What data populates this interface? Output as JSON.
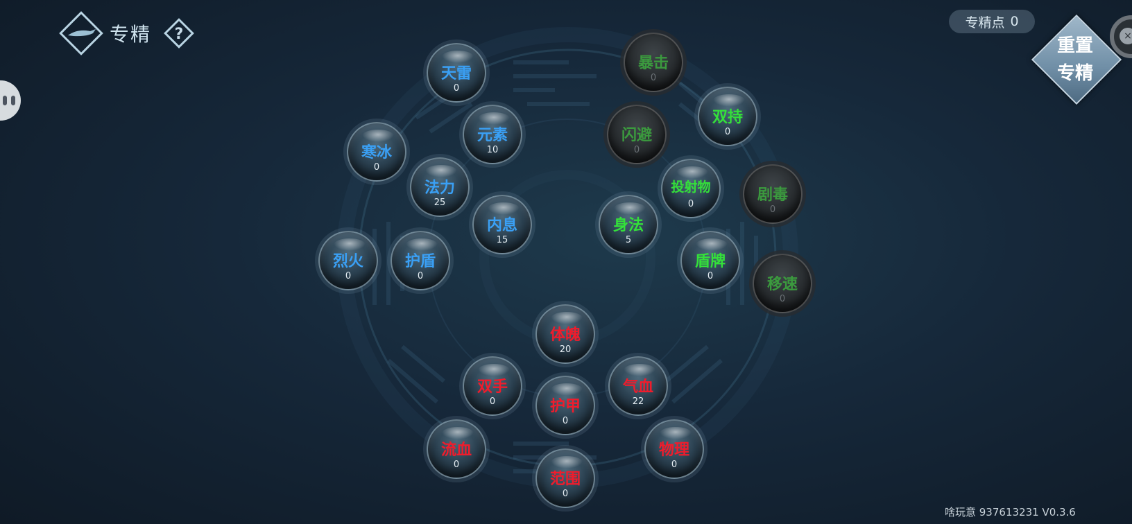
{
  "header": {
    "title": "专精"
  },
  "points": {
    "label": "专精点",
    "value": "0"
  },
  "reset": {
    "line1": "重置",
    "line2": "专精"
  },
  "colors": {
    "blue": "#3aa0f5",
    "green": "#34e03a",
    "red": "#f01c2c",
    "locked": "#3b9a3e"
  },
  "nodes": [
    {
      "name": "天雷",
      "value": "0",
      "group": "blue",
      "locked": false
    },
    {
      "name": "元素",
      "value": "10",
      "group": "blue",
      "locked": false
    },
    {
      "name": "寒冰",
      "value": "0",
      "group": "blue",
      "locked": false
    },
    {
      "name": "法力",
      "value": "25",
      "group": "blue",
      "locked": false
    },
    {
      "name": "内息",
      "value": "15",
      "group": "blue",
      "locked": false
    },
    {
      "name": "烈火",
      "value": "0",
      "group": "blue",
      "locked": false
    },
    {
      "name": "护盾",
      "value": "0",
      "group": "blue",
      "locked": false
    },
    {
      "name": "暴击",
      "value": "0",
      "group": "green",
      "locked": true
    },
    {
      "name": "双持",
      "value": "0",
      "group": "green",
      "locked": false
    },
    {
      "name": "闪避",
      "value": "0",
      "group": "green",
      "locked": true
    },
    {
      "name": "投射物",
      "value": "0",
      "group": "green",
      "locked": false
    },
    {
      "name": "剧毒",
      "value": "0",
      "group": "green",
      "locked": true
    },
    {
      "name": "身法",
      "value": "5",
      "group": "green",
      "locked": false
    },
    {
      "name": "盾牌",
      "value": "0",
      "group": "green",
      "locked": false
    },
    {
      "name": "移速",
      "value": "0",
      "group": "green",
      "locked": true
    },
    {
      "name": "体魄",
      "value": "20",
      "group": "red",
      "locked": false
    },
    {
      "name": "双手",
      "value": "0",
      "group": "red",
      "locked": false
    },
    {
      "name": "气血",
      "value": "22",
      "group": "red",
      "locked": false
    },
    {
      "name": "护甲",
      "value": "0",
      "group": "red",
      "locked": false
    },
    {
      "name": "流血",
      "value": "0",
      "group": "red",
      "locked": false
    },
    {
      "name": "物理",
      "value": "0",
      "group": "red",
      "locked": false
    },
    {
      "name": "范围",
      "value": "0",
      "group": "red",
      "locked": false
    }
  ],
  "footer": {
    "version": "啥玩意 937613231 V0.3.6"
  }
}
